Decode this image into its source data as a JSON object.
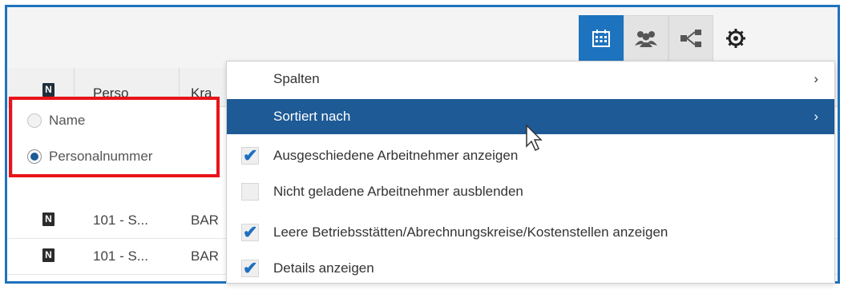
{
  "toolbar": {
    "buttons": [
      {
        "name": "calendar-icon",
        "active": true
      },
      {
        "name": "people-icon",
        "active": false
      },
      {
        "name": "hierarchy-icon",
        "active": false
      },
      {
        "name": "gear-icon",
        "active": false
      }
    ]
  },
  "grid": {
    "header": {
      "icon_letter": "N",
      "col_perso": "Perso",
      "col_kra": "Kra"
    },
    "rows": [
      {
        "icon_letter": "N",
        "perso": "101 - S...",
        "kra": "BAR"
      },
      {
        "icon_letter": "N",
        "perso": "101 - S...",
        "kra": "BAR"
      }
    ]
  },
  "sort_options": {
    "name_label": "Name",
    "personalnummer_label": "Personalnummer",
    "selected": "Personalnummer"
  },
  "menu": {
    "spalten": "Spalten",
    "sortiert_nach": "Sortiert nach",
    "chevron": "›",
    "ausgeschiedene": "Ausgeschiedene Arbeitnehmer anzeigen",
    "nicht_geladene": "Nicht geladene Arbeitnehmer ausblenden",
    "leere": "Leere Betriebsstätten/Abrechnungskreise/Kostenstellen anzeigen",
    "details": "Details anzeigen",
    "checked": {
      "ausgeschiedene": true,
      "nicht_geladene": false,
      "leere": true,
      "details": true
    }
  },
  "colors": {
    "accent": "#1e73be",
    "selected_bg": "#1e5a96",
    "highlight": "#e8141a"
  }
}
